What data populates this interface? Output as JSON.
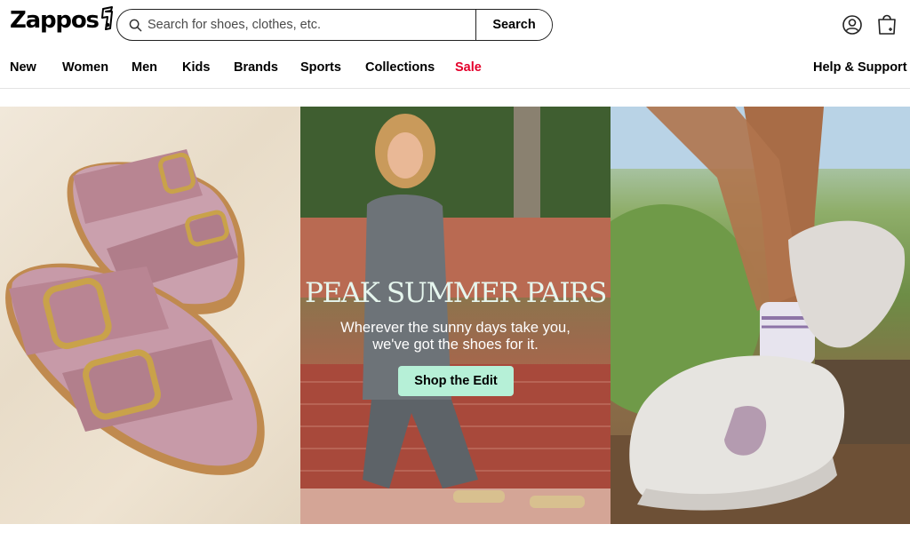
{
  "header": {
    "logo_text": "Zappos",
    "search": {
      "placeholder": "Search for shoes, clothes, etc.",
      "button_label": "Search"
    },
    "icons": [
      "search-icon",
      "account-icon",
      "cart-icon"
    ]
  },
  "nav": {
    "items": [
      {
        "label": "New"
      },
      {
        "label": "Women"
      },
      {
        "label": "Men"
      },
      {
        "label": "Kids"
      },
      {
        "label": "Brands"
      },
      {
        "label": "Sports"
      },
      {
        "label": "Collections"
      },
      {
        "label": "Sale"
      }
    ],
    "help_label": "Help & Support",
    "sale_color": "#e4002b"
  },
  "hero": {
    "headline": "PEAK SUMMER PAIRS",
    "subtext_line1": "Wherever the sunny days take you,",
    "subtext_line2": "we've got the shoes for it.",
    "cta_label": "Shop the Edit",
    "cta_color": "#b6f0d7"
  }
}
